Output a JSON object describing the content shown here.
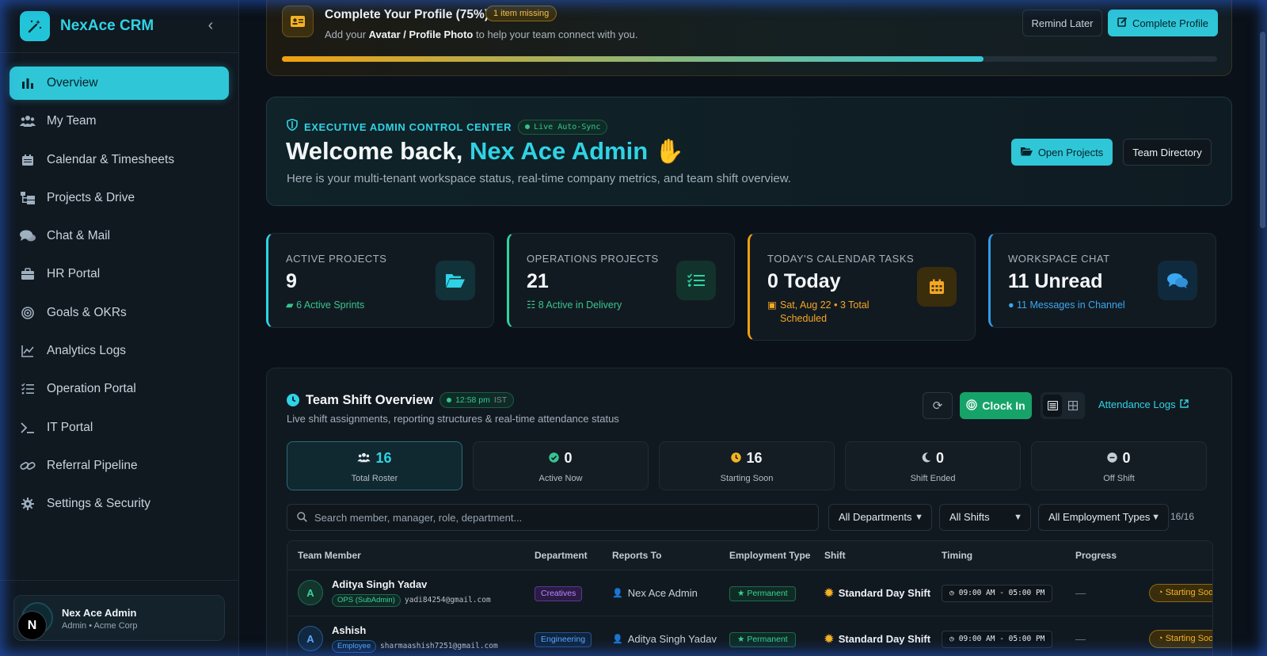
{
  "brand": {
    "name": "NexAce CRM"
  },
  "sidebar": {
    "items": [
      {
        "label": "Overview",
        "icon": "bar-chart-icon",
        "active": true
      },
      {
        "label": "My Team",
        "icon": "users-icon"
      },
      {
        "label": "Calendar & Timesheets",
        "icon": "calendar-icon"
      },
      {
        "label": "Projects & Drive",
        "icon": "folder-tree-icon"
      },
      {
        "label": "Chat & Mail",
        "icon": "chat-icon"
      },
      {
        "label": "HR Portal",
        "icon": "briefcase-icon"
      },
      {
        "label": "Goals & OKRs",
        "icon": "target-icon"
      },
      {
        "label": "Analytics Logs",
        "icon": "line-chart-icon"
      },
      {
        "label": "Operation Portal",
        "icon": "list-check-icon"
      },
      {
        "label": "IT Portal",
        "icon": "terminal-icon"
      },
      {
        "label": "Referral Pipeline",
        "icon": "link-icon"
      },
      {
        "label": "Settings & Security",
        "icon": "gear-icon"
      }
    ],
    "user": {
      "name": "Nex Ace Admin",
      "role": "Admin • Acme Corp",
      "badge": "N"
    }
  },
  "banner": {
    "title": "Complete Your Profile (75%)",
    "pill": "1 item missing",
    "sub_prefix": "Add your ",
    "sub_bold": "Avatar / Profile Photo",
    "sub_suffix": " to help your team connect with you.",
    "remind_label": "Remind Later",
    "complete_label": "Complete Profile",
    "progress": 0.75
  },
  "hero": {
    "tag": "EXECUTIVE ADMIN CONTROL CENTER",
    "live": "Live Auto-Sync",
    "greeting": "Welcome back, ",
    "name": "Nex Ace Admin",
    "emoji": "👋",
    "subtitle": "Here is your multi-tenant workspace status, real-time company metrics, and team shift overview.",
    "open_projects_label": "Open Projects",
    "team_directory_label": "Team Directory"
  },
  "stats": [
    {
      "label": "ACTIVE PROJECTS",
      "value": "9",
      "note": "6 Active Sprints",
      "accent": "#2fd3e5",
      "note_color": "#36c58f",
      "icon": "folder-open-icon"
    },
    {
      "label": "OPERATIONS PROJECTS",
      "value": "21",
      "note": "8 Active in Delivery",
      "accent": "#2fd3a0",
      "note_color": "#36c58f",
      "icon": "list-check-icon"
    },
    {
      "label": "TODAY'S CALENDAR TASKS",
      "value": "0 Today",
      "note": "Sat, Aug 22 • 3 Total Scheduled",
      "accent": "#f0a010",
      "note_color": "#f5a623",
      "icon": "calendar-icon"
    },
    {
      "label": "WORKSPACE CHAT",
      "value": "11 Unread",
      "note": "11 Messages in Channel",
      "accent": "#2f9ce5",
      "note_color": "#3aa8f0",
      "icon": "chat-icon"
    }
  ],
  "shift": {
    "title": "Team Shift Overview",
    "time": "12:58 pm",
    "tz": "IST",
    "subtitle": "Live shift assignments, reporting structures & real-time attendance status",
    "clock_in_label": "Clock In",
    "attendance_label": "Attendance Logs",
    "counters": [
      {
        "value": "16",
        "label": "Total Roster",
        "icon": "users-icon",
        "color": "#e6edf3"
      },
      {
        "value": "0",
        "label": "Active Now",
        "icon": "check-circle-icon",
        "color": "#36c58f"
      },
      {
        "value": "16",
        "label": "Starting Soon",
        "icon": "clock-icon",
        "color": "#f5b323"
      },
      {
        "value": "0",
        "label": "Shift Ended",
        "icon": "moon-icon",
        "color": "#c6cdd4"
      },
      {
        "value": "0",
        "label": "Off Shift",
        "icon": "minus-circle-icon",
        "color": "#c6cdd4"
      }
    ],
    "search_placeholder": "Search member, manager, role, department...",
    "filters": {
      "department": "All Departments",
      "shift": "All Shifts",
      "employment": "All Employment Types"
    },
    "count": "16/16",
    "columns": [
      "Team Member",
      "Department",
      "Reports To",
      "Employment Type",
      "Shift",
      "Timing",
      "Progress"
    ],
    "rows": [
      {
        "initial": "A",
        "name": "Aditya Singh Yadav",
        "role": "OPS (SubAdmin)",
        "email": "yadi84254@gmail.com",
        "department": "Creatives",
        "reports_to": "Nex Ace Admin",
        "employment": "Permanent",
        "shift": "Standard Day Shift",
        "timing": "09:00 AM - 05:00 PM",
        "progress": "—",
        "status": "Starting Soon"
      },
      {
        "initial": "A",
        "name": "Ashish",
        "role": "Employee",
        "email": "sharmaashish7251@gmail.com",
        "department": "Engineering",
        "reports_to": "Aditya Singh Yadav",
        "employment": "Permanent",
        "shift": "Standard Day Shift",
        "timing": "09:00 AM - 05:00 PM",
        "progress": "—",
        "status": "Starting Soon"
      }
    ]
  }
}
